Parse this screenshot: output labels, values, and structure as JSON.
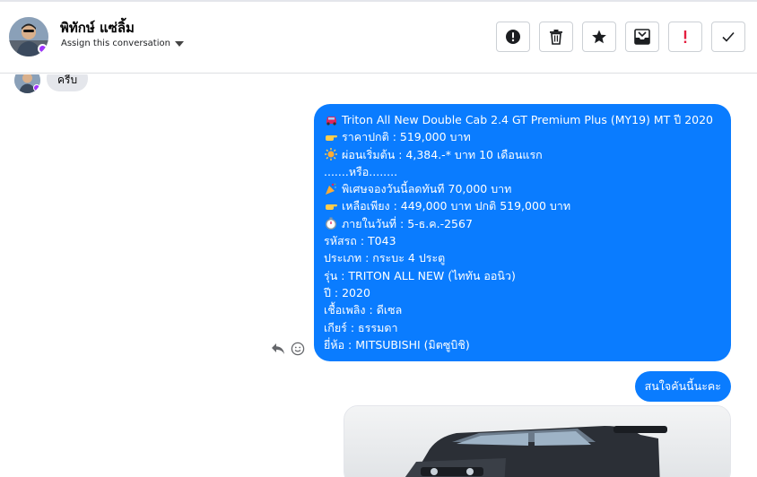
{
  "header": {
    "contact_name": "พิทักษ์ แซ่ลิ้ม",
    "assign_label": "Assign this conversation"
  },
  "toolbar": {
    "buttons": [
      {
        "icon": "alert-circle-icon"
      },
      {
        "icon": "trash-icon"
      },
      {
        "icon": "star-icon"
      },
      {
        "icon": "archive-icon"
      },
      {
        "icon": "exclamation-icon",
        "color": "#e41e3f"
      },
      {
        "icon": "checkmark-icon"
      }
    ]
  },
  "messages": {
    "incoming_1": "ครีบ",
    "outgoing_1": [
      {
        "icon": "car-icon",
        "text": "Triton All New Double Cab 2.4 GT Premium Plus (MY19) MT ปี 2020"
      },
      {
        "icon": "pointing-hand-icon",
        "text": "ราคาปกติ : 519,000 บาท"
      },
      {
        "icon": "sun-icon",
        "text": "ผ่อนเริ่มต้น : 4,384.-* บาท 10 เดือนแรก"
      },
      {
        "icon": "",
        "text": ".......หรือ........"
      },
      {
        "icon": "party-popper-icon",
        "text": "พิเศษจองวันนี้ลดทันที 70,000 บาท"
      },
      {
        "icon": "pointing-hand-icon",
        "text": "เหลือเพียง : 449,000 บาท ปกติ 519,000 บาท"
      },
      {
        "icon": "stopwatch-icon",
        "text": "ภายในวันที่ : 5-ธ.ค.-2567"
      },
      {
        "icon": "",
        "text": "รหัสรถ : T043"
      },
      {
        "icon": "",
        "text": "ประเภท : กระบะ 4 ประตู"
      },
      {
        "icon": "",
        "text": "รุ่น : TRITON ALL NEW (ไททัน ออนิว)"
      },
      {
        "icon": "",
        "text": "ปี : 2020"
      },
      {
        "icon": "",
        "text": "เชื้อเพลิง : ดีเซล"
      },
      {
        "icon": "",
        "text": "เกียร์ : ธรรมดา"
      },
      {
        "icon": "",
        "text": "ยี่ห้อ : MITSUBISHI (มิตซูบิชิ)"
      }
    ],
    "outgoing_2": "สนใจคันนี้นะคะ"
  },
  "colors": {
    "accent": "#0a7cff",
    "incoming_bubble": "#e4e6eb",
    "badge": "#a033ff"
  }
}
